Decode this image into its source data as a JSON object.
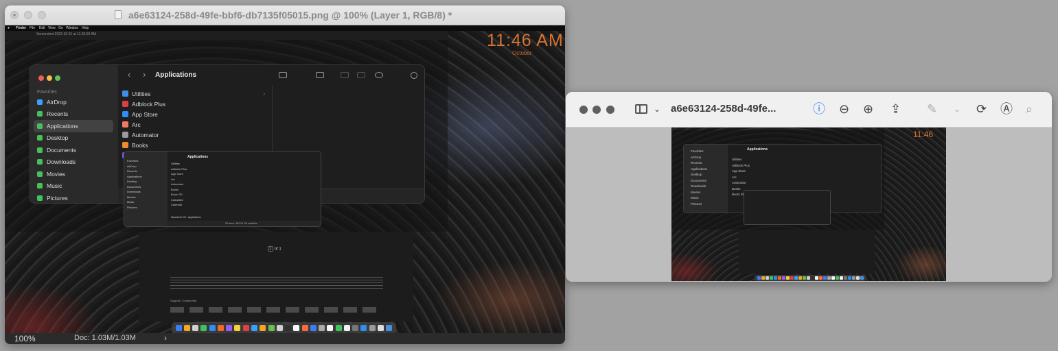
{
  "editor": {
    "title": "a6e63124-258d-49fe-bbf6-db7135f05015.png @ 100% (Layer 1, RGB/8) *",
    "zoom": "100%",
    "doc_size": "Doc: 1.03M/1.03M",
    "chevron": "›"
  },
  "screenshot": {
    "menubar": [
      "Finder",
      "File",
      "Edit",
      "View",
      "Go",
      "Window",
      "Help"
    ],
    "doc_title": "Screenshot 2023-10-31 at 11.30.50 AM",
    "clock": "11:46 AM",
    "clock_date": "October",
    "finder": {
      "title": "Applications",
      "favorites_label": "Favorites",
      "sidebar": [
        {
          "label": "AirDrop",
          "color": "#3aa0ff"
        },
        {
          "label": "Recents",
          "color": "#44c15a"
        },
        {
          "label": "Applications",
          "color": "#44c15a",
          "selected": true
        },
        {
          "label": "Desktop",
          "color": "#44c15a"
        },
        {
          "label": "Documents",
          "color": "#44c15a"
        },
        {
          "label": "Downloads",
          "color": "#44c15a"
        },
        {
          "label": "Movies",
          "color": "#44c15a"
        },
        {
          "label": "Music",
          "color": "#44c15a"
        },
        {
          "label": "Pictures",
          "color": "#44c15a"
        }
      ],
      "files": [
        {
          "label": "Utilities",
          "color": "#3d8ee8"
        },
        {
          "label": "Adblock Plus",
          "color": "#d94141"
        },
        {
          "label": "App Store",
          "color": "#2f8df3"
        },
        {
          "label": "Arc",
          "color": "#f07a6a"
        },
        {
          "label": "Automator",
          "color": "#9a9a9a"
        },
        {
          "label": "Books",
          "color": "#f08a2a"
        },
        {
          "label": "Boom 3D",
          "color": "#6a5cf0"
        }
      ],
      "utilities_chevron": "›"
    },
    "finder_small": {
      "title": "Applications",
      "sidebar": [
        "Favorites",
        "AirDrop",
        "Recents",
        "Applications",
        "Desktop",
        "Documents",
        "Downloads",
        "Movies",
        "Music",
        "Pictures"
      ],
      "files": [
        "Utilities",
        "Adblock Plus",
        "App Store",
        "Arc",
        "Automator",
        "Books",
        "Boom 3D",
        "Calculator",
        "Calendar"
      ],
      "path": "Macintosh HD › Applications",
      "status": "53 items, 380.34 GB available"
    },
    "page": {
      "pager_value": "1",
      "pager_of": "of 1",
      "support": "Support",
      "community": "Community"
    },
    "dock_colors": [
      "#3a7df5",
      "#f5a623",
      "#d0d0d0",
      "#3fc35b",
      "#2f8df3",
      "#f06a2a",
      "#9a5cf0",
      "#f5d03a",
      "#e04040",
      "#3aa0ff",
      "#f5a623",
      "#6ac04a",
      "#d0d0d0",
      "#2f2f2f",
      "#fafafa",
      "#ff6a3a",
      "#3a7df5",
      "#aaa",
      "#f5f5f5",
      "#3fc35b",
      "#f0f0f0",
      "#777",
      "#2f8df3",
      "#9a9a9a",
      "#ddd",
      "#4a90e2"
    ]
  },
  "preview": {
    "title": "a6e63124-258d-49fe...",
    "thumb": {
      "clock": "11:46",
      "finder_title": "Applications",
      "sidebar": [
        "Favorites",
        "AirDrop",
        "Recents",
        "Applications",
        "Desktop",
        "Documents",
        "Downloads",
        "Movies",
        "Music",
        "Pictures"
      ],
      "files": [
        "Utilities",
        "Adblock Plus",
        "App Store",
        "Arc",
        "Automator",
        "Books",
        "Boom 3D"
      ]
    }
  }
}
